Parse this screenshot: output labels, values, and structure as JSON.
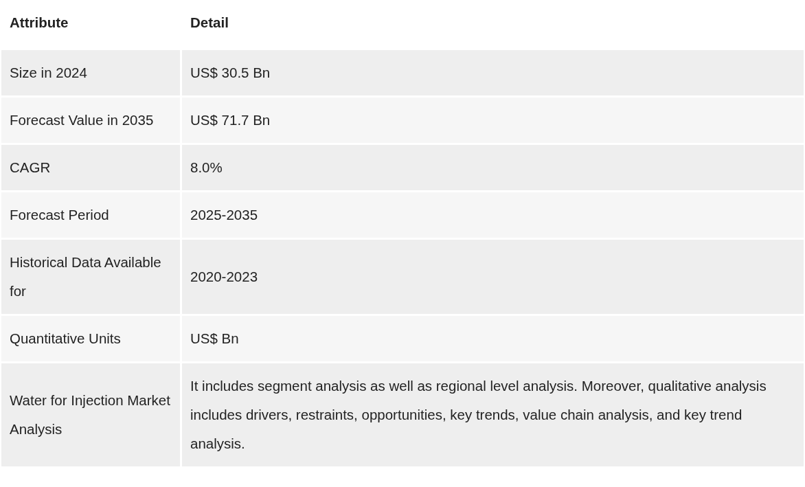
{
  "table": {
    "columns": [
      "Attribute",
      "Detail"
    ],
    "rows": [
      {
        "attribute": "Size in 2024",
        "detail": "US$ 30.5 Bn"
      },
      {
        "attribute": "Forecast Value in 2035",
        "detail": "US$ 71.7 Bn"
      },
      {
        "attribute": "CAGR",
        "detail": "8.0%"
      },
      {
        "attribute": "Forecast Period",
        "detail": "2025-2035"
      },
      {
        "attribute": "Historical Data Available for",
        "detail": "2020-2023"
      },
      {
        "attribute": "Quantitative Units",
        "detail": "US$ Bn"
      },
      {
        "attribute": "Water for Injection Market Analysis",
        "detail": "It includes segment analysis as well as regional level analysis. Moreover, qualitative analysis includes drivers, restraints, opportunities, key trends, value chain analysis, and key trend analysis."
      }
    ]
  }
}
